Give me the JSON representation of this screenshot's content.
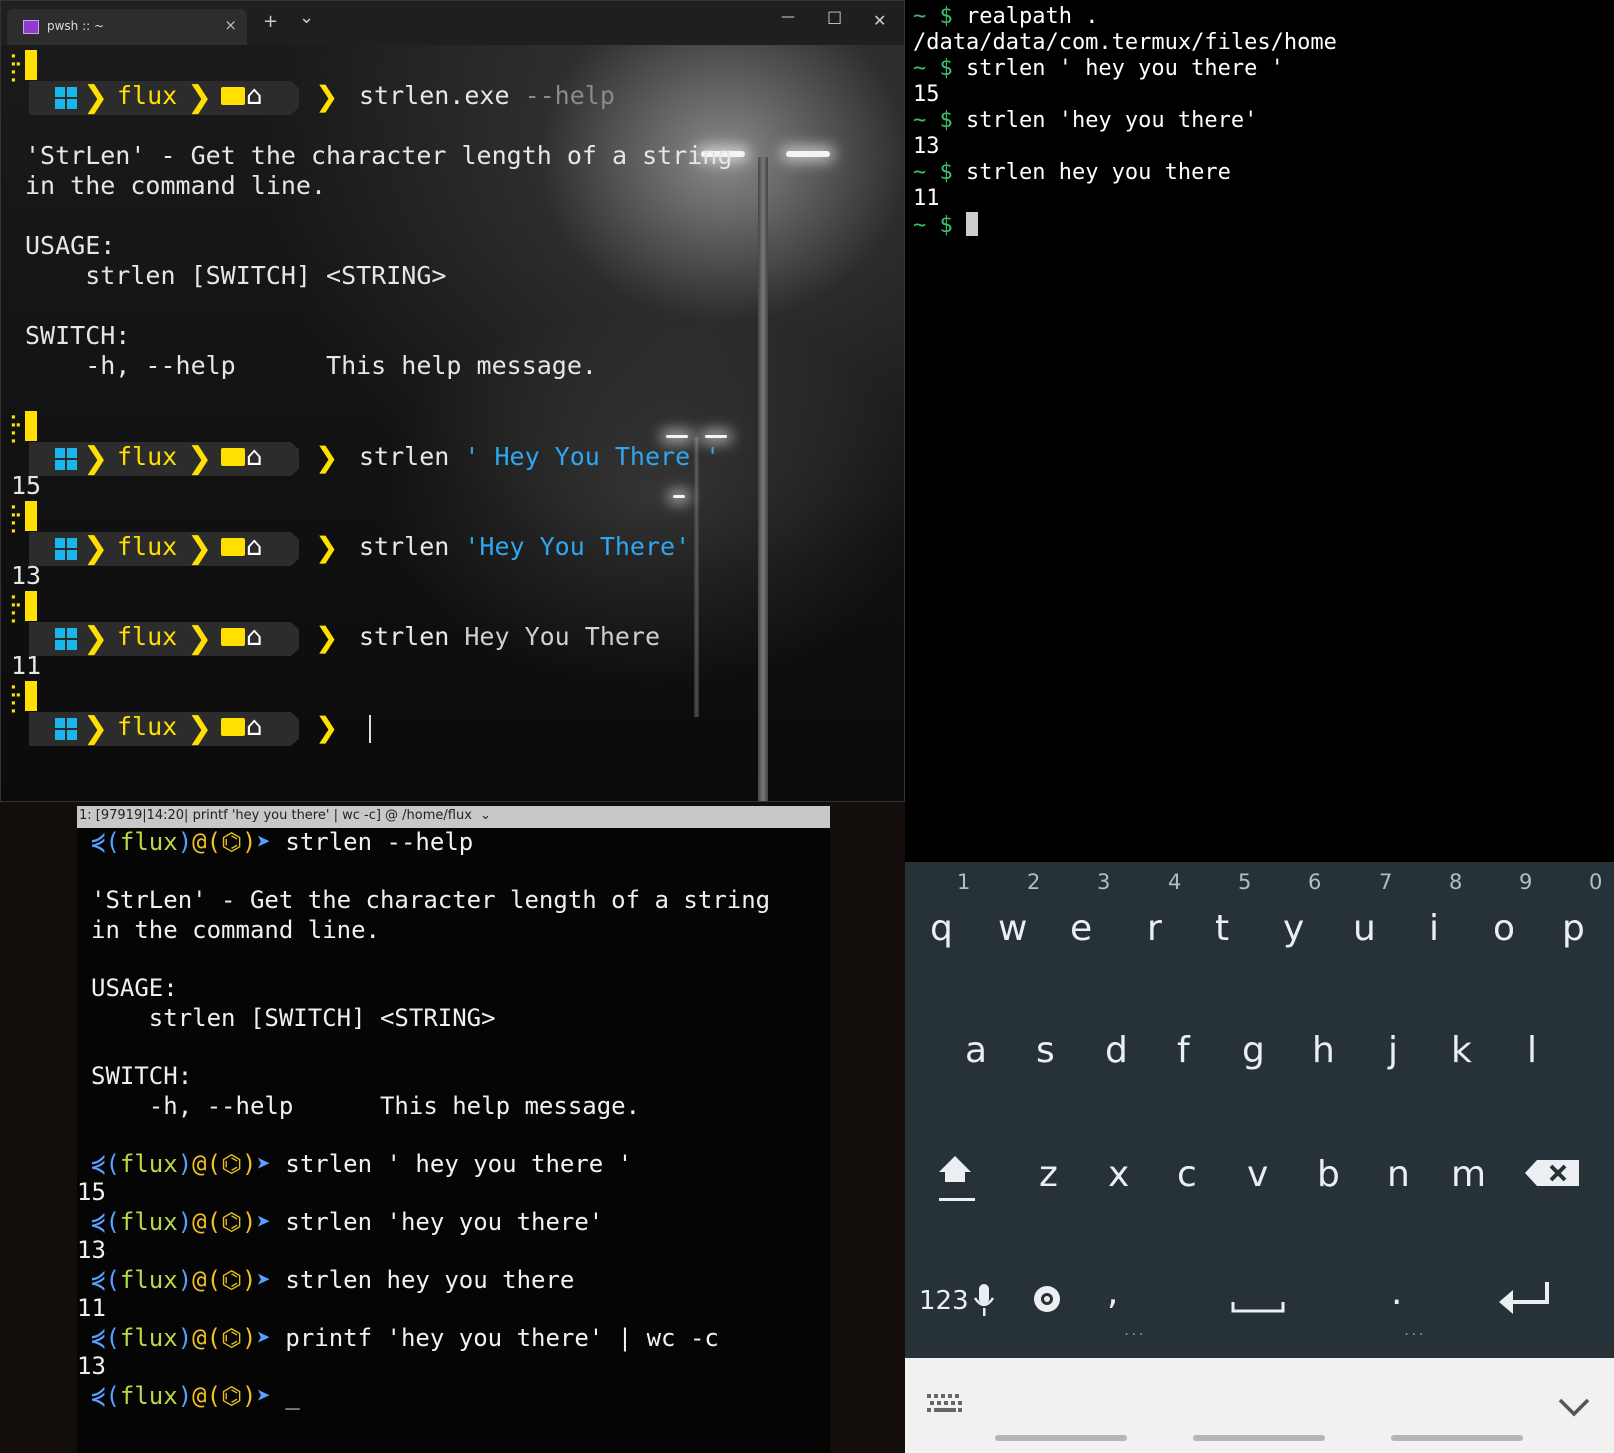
{
  "windows_terminal": {
    "tab_title": "pwsh :: ~",
    "tab_close": "×",
    "new_tab": "+",
    "dropdown": "⌄",
    "minimize": "—",
    "maximize": "☐",
    "close": "✕",
    "prompt_user": "flux",
    "blocks": [
      {
        "cmd": "strlen.exe",
        "arg": " --help",
        "arg_style": "dim"
      },
      {
        "cmd": "strlen",
        "arg": " ' Hey You There '",
        "arg_style": "blue",
        "output": "15"
      },
      {
        "cmd": "strlen",
        "arg": " 'Hey You There'",
        "arg_style": "blue",
        "output": "13"
      },
      {
        "cmd": "strlen",
        "arg": " Hey You There",
        "arg_style": "plain",
        "output": "11"
      },
      {
        "cmd": "",
        "arg": "",
        "arg_style": "plain"
      }
    ],
    "help_text": [
      "'StrLen' - Get the character length of a string",
      "in the command line.",
      "",
      "USAGE:",
      "    strlen [SWITCH] <STRING>",
      "",
      "SWITCH:",
      "    -h, --help      This help message."
    ]
  },
  "termux": {
    "lines": [
      {
        "prompt": "~ $ ",
        "text": "realpath ."
      },
      {
        "prompt": "",
        "text": "/data/data/com.termux/files/home"
      },
      {
        "prompt": "~ $ ",
        "text": "strlen ' hey you there '"
      },
      {
        "prompt": "",
        "text": "15"
      },
      {
        "prompt": "~ $ ",
        "text": "strlen 'hey you there'"
      },
      {
        "prompt": "",
        "text": "13"
      },
      {
        "prompt": "~ $ ",
        "text": "strlen hey you there"
      },
      {
        "prompt": "",
        "text": "11"
      },
      {
        "prompt": "~ $ ",
        "text": ""
      }
    ]
  },
  "keyboard": {
    "numbers": [
      "1",
      "2",
      "3",
      "4",
      "5",
      "6",
      "7",
      "8",
      "9",
      "0"
    ],
    "row1": [
      "q",
      "w",
      "e",
      "r",
      "t",
      "y",
      "u",
      "i",
      "o",
      "p"
    ],
    "row2": [
      "a",
      "s",
      "d",
      "f",
      "g",
      "h",
      "j",
      "k",
      "l"
    ],
    "row3": [
      "z",
      "x",
      "c",
      "v",
      "b",
      "n",
      "m"
    ],
    "mode_label": "123",
    "comma": ",",
    "period": ".",
    "icons": [
      "shift-icon",
      "backspace-icon",
      "mic-icon",
      "settings-icon",
      "space-icon",
      "enter-icon",
      "keyboard-grid-icon",
      "chevron-down-icon"
    ]
  },
  "bottom_terminal": {
    "title": "1: [97919|14:20| printf 'hey you there' | wc -c] @ /home/flux  ⌄",
    "prompt_user": "flux",
    "first_cmd": "strlen --help",
    "help_text": [
      "'StrLen' - Get the character length of a string",
      "in the command line.",
      "",
      "USAGE:",
      "    strlen [SWITCH] <STRING>",
      "",
      "SWITCH:",
      "    -h, --help      This help message."
    ],
    "commands": [
      {
        "cmd": "strlen ' hey you there '",
        "output": "15"
      },
      {
        "cmd": "strlen 'hey you there'",
        "output": "13"
      },
      {
        "cmd": "strlen hey you there",
        "output": "11"
      },
      {
        "cmd": "printf 'hey you there' | wc -c",
        "output": "13"
      },
      {
        "cmd": "_",
        "output": ""
      }
    ]
  }
}
